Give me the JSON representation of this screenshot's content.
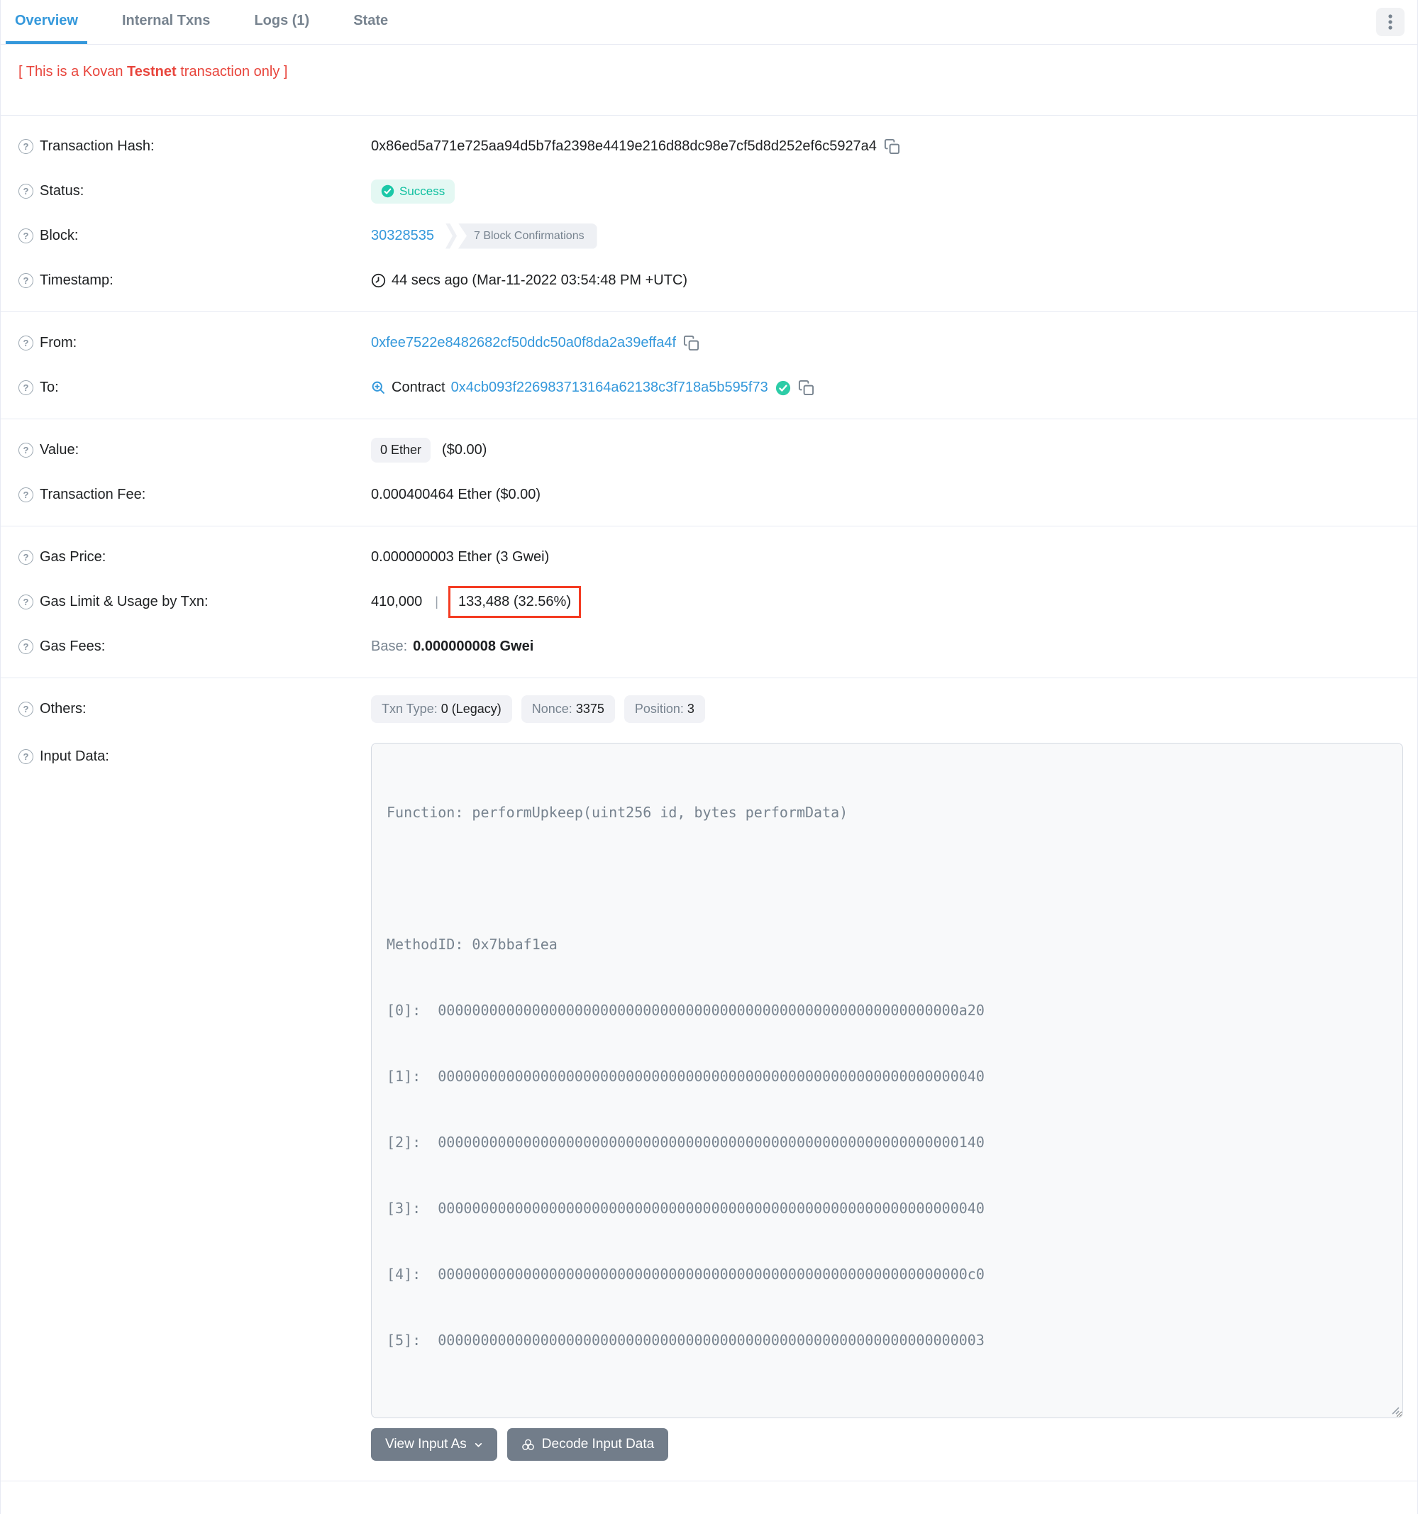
{
  "tabs": [
    {
      "label": "Overview",
      "active": true
    },
    {
      "label": "Internal Txns",
      "active": false
    },
    {
      "label": "Logs (1)",
      "active": false
    },
    {
      "label": "State",
      "active": false
    }
  ],
  "notice": {
    "prefix": "[ This is a Kovan ",
    "bold": "Testnet",
    "suffix": " transaction only ]"
  },
  "icons": {
    "help": "?"
  },
  "rows": {
    "transaction_hash": {
      "label": "Transaction Hash:",
      "value": "0x86ed5a771e725aa94d5b7fa2398e4419e216d88dc98e7cf5d8d252ef6c5927a4"
    },
    "status": {
      "label": "Status:",
      "value": "Success"
    },
    "block": {
      "label": "Block:",
      "number": "30328535",
      "confirmations": "7 Block Confirmations"
    },
    "timestamp": {
      "label": "Timestamp:",
      "value": "44 secs ago (Mar-11-2022 03:54:48 PM +UTC)"
    },
    "from": {
      "label": "From:",
      "address": "0xfee7522e8482682cf50ddc50a0f8da2a39effa4f"
    },
    "to": {
      "label": "To:",
      "prefix": "Contract",
      "address": "0x4cb093f226983713164a62138c3f718a5b595f73"
    },
    "value": {
      "label": "Value:",
      "amount": "0 Ether",
      "usd": "($0.00)"
    },
    "transaction_fee": {
      "label": "Transaction Fee:",
      "value": "0.000400464 Ether ($0.00)"
    },
    "gas_price": {
      "label": "Gas Price:",
      "value": "0.000000003 Ether (3 Gwei)"
    },
    "gas_limit_usage": {
      "label": "Gas Limit & Usage by Txn:",
      "limit": "410,000",
      "separator": "|",
      "usage": "133,488 (32.56%)"
    },
    "gas_fees": {
      "label": "Gas Fees:",
      "base_label": "Base:",
      "base_value": "0.000000008 Gwei"
    },
    "others": {
      "label": "Others:",
      "txn_type_label": "Txn Type: ",
      "txn_type_value": "0 (Legacy)",
      "nonce_label": "Nonce: ",
      "nonce_value": "3375",
      "position_label": "Position: ",
      "position_value": "3"
    },
    "input_data": {
      "label": "Input Data:",
      "function_line": "Function: performUpkeep(uint256 id, bytes performData)",
      "method_id_line": "MethodID: 0x7bbaf1ea",
      "params": [
        {
          "key": "[0]:  ",
          "value": "0000000000000000000000000000000000000000000000000000000000000a20"
        },
        {
          "key": "[1]:  ",
          "value": "0000000000000000000000000000000000000000000000000000000000000040"
        },
        {
          "key": "[2]:  ",
          "value": "0000000000000000000000000000000000000000000000000000000000000140"
        },
        {
          "key": "[3]:  ",
          "value": "0000000000000000000000000000000000000000000000000000000000000040"
        },
        {
          "key": "[4]:  ",
          "value": "00000000000000000000000000000000000000000000000000000000000000c0"
        },
        {
          "key": "[5]:  ",
          "value": "0000000000000000000000000000000000000000000000000000000000000003"
        }
      ]
    }
  },
  "buttons": {
    "view_input_as": "View Input As",
    "decode_input_data": "Decode Input Data"
  },
  "colors": {
    "accent_blue": "#3498db",
    "success_teal": "#00c9a7",
    "danger_red": "#e8453c",
    "annotation_red": "#f43b22",
    "muted_gray": "#77838f",
    "divider": "#e7eaf3",
    "button_gray": "#727d8a"
  }
}
